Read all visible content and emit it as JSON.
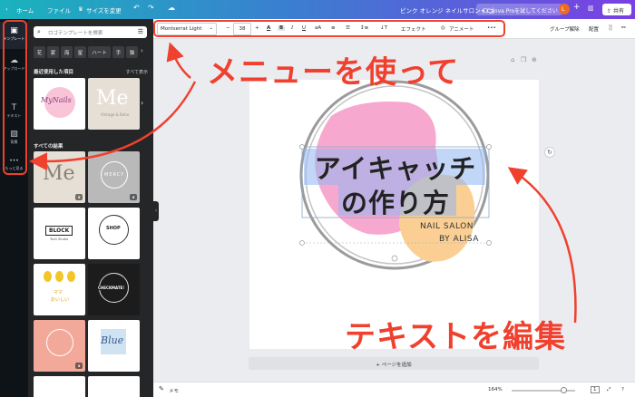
{
  "topbar": {
    "home": "ホーム",
    "file": "ファイル",
    "resize": "サイズを変更",
    "title": "ピンク オレンジ ネイルサロン ロゴ",
    "pro_button": "Canva Proを試してください",
    "avatar": "L",
    "share": "共有"
  },
  "rail": [
    {
      "icon": "template-icon",
      "label": "テンプレート",
      "glyph": "▣"
    },
    {
      "icon": "upload-icon",
      "label": "アップロード",
      "glyph": "☁"
    },
    {
      "icon": "text-icon",
      "label": "テキスト",
      "glyph": "T"
    },
    {
      "icon": "background-icon",
      "label": "背景",
      "glyph": "▨"
    },
    {
      "icon": "more-icon",
      "label": "もっと見る",
      "glyph": "•••"
    }
  ],
  "panel": {
    "search_placeholder": "ロゴテンプレートを検索",
    "chips": [
      "花",
      "家",
      "海",
      "星",
      "ハート",
      "手",
      "猫"
    ],
    "recent_title": "最近使用した項目",
    "see_all": "すべて表示",
    "all_results": "すべての結果"
  },
  "thumbs": {
    "t1": "MyNails",
    "t2": "Me",
    "t2_sub": "Vintage & Boho",
    "t3": "Me",
    "t4": "MERCY",
    "t5": "BLOCK",
    "t5_sub": "Tech Studio",
    "t6": "SHOP",
    "t7": "ママ",
    "t7_sub": "おいしい",
    "t8": "CHECKMATE!",
    "t10": "Blue"
  },
  "toolbar": {
    "font": "Montserrat Light",
    "minus": "−",
    "size": "38",
    "plus": "+",
    "effects": "エフェクト",
    "animate": "アニメート",
    "more": "•••",
    "ungroup": "グループ解除",
    "arrange": "配置"
  },
  "canvas": {
    "headline_1": "アイキャッチ",
    "headline_2": "の作り方",
    "sub_1": "NAIL SALON",
    "sub_2": "BY ALISA",
    "add_page": "+ ページを追加"
  },
  "bottombar": {
    "notes": "メモ",
    "zoom": "164%",
    "page_no": "1"
  },
  "annotations": {
    "menu": "メニューを使って",
    "edit_text": "テキストを編集"
  },
  "colors": {
    "accent_red": "#f0402e",
    "pink": "#f7a8cf",
    "orange": "#fbcf93",
    "blue_sel": "#8fb7f2"
  }
}
